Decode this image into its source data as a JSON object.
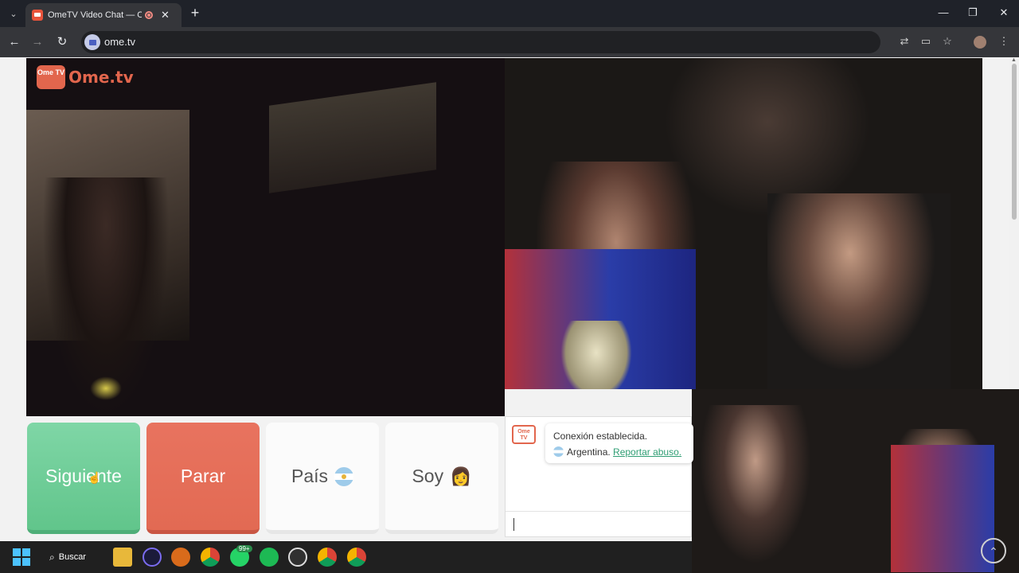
{
  "browser": {
    "tab_title": "OmeTV Video Chat — Ome",
    "tab_close": "✕",
    "new_tab": "+",
    "url": "ome.tv",
    "window_controls": {
      "minimize": "—",
      "maximize": "❐",
      "close": "✕"
    }
  },
  "site": {
    "logo_badge": "Ome TV",
    "logo_text": "Ome.tv"
  },
  "controls": {
    "next_label": "Siguiente",
    "stop_label": "Parar",
    "country_label": "País",
    "gender_label": "Soy",
    "gender_emoji": "👩"
  },
  "chat": {
    "status": "Conexión establecida.",
    "country": "Argentina.",
    "report_link": "Reportar abuso.",
    "input_placeholder": ""
  },
  "taskbar": {
    "search_label": "Buscar",
    "whatsapp_badge": "99+"
  },
  "icons": {
    "back": "back-arrow-icon",
    "forward": "forward-arrow-icon",
    "reload": "reload-icon",
    "translate": "translate-icon",
    "cast": "cast-icon",
    "star": "bookmark-star-icon"
  },
  "colors": {
    "next_button": "#6fcf97",
    "stop_button": "#e46c56",
    "brand": "#e2664d",
    "link": "#2f9e74"
  }
}
